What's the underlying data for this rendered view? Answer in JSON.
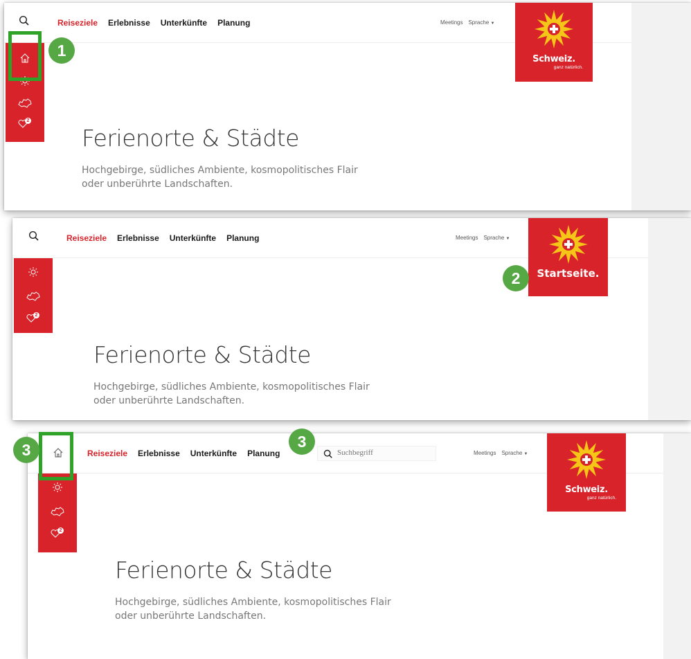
{
  "colors": {
    "brand_red": "#d8232a",
    "highlight_green": "#2fa327",
    "badge_green": "#56a844"
  },
  "nav": {
    "items": [
      "Reiseziele",
      "Erlebnisse",
      "Unterkünfte",
      "Planung"
    ],
    "active": "Reiseziele"
  },
  "meta": {
    "meetings": "Meetings",
    "sprache": "Sprache"
  },
  "logo": {
    "brand": "Schweiz.",
    "tagline": "ganz natürlich.",
    "hover_label": "Startseite."
  },
  "hero": {
    "title": "Ferienorte & Städte",
    "subtitle_line1": "Hochgebirge, südliches Ambiente, kosmopolitisches Flair",
    "subtitle_line2": "oder unberührte Landschaften."
  },
  "search": {
    "placeholder": "Suchbegriff"
  },
  "sidebar": {
    "icons": [
      "home-icon",
      "sun-icon",
      "switzerland-map-icon",
      "heart-icon"
    ],
    "favorites_count": "2"
  },
  "annotations": {
    "step1": "1",
    "step2": "2",
    "step3": "3"
  }
}
